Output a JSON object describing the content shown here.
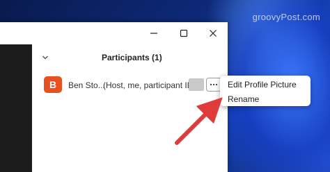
{
  "watermark": "groovyPost.com",
  "window_controls": {
    "minimize_icon": "minimize-icon",
    "maximize_icon": "maximize-icon",
    "close_icon": "close-icon"
  },
  "participants_panel": {
    "title": "Participants (1)",
    "collapse_icon": "chevron-down-icon",
    "participants": [
      {
        "avatar_letter": "B",
        "avatar_color": "#e8501f",
        "name": "Ben Sto...",
        "role_text": "(Host, me, participant ID:"
      }
    ]
  },
  "context_menu": {
    "items": [
      {
        "label": "Edit Profile Picture"
      },
      {
        "label": "Rename"
      }
    ]
  },
  "annotation": {
    "arrow_color": "#e03a3a"
  }
}
